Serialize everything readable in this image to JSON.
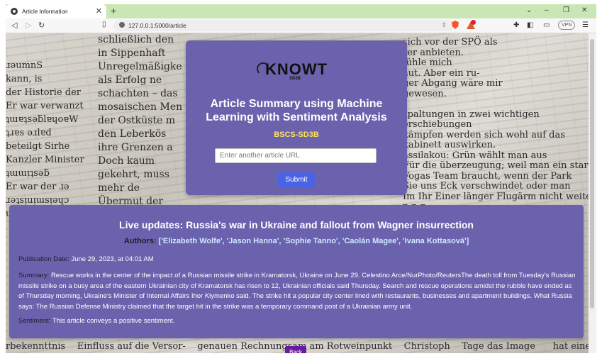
{
  "browser": {
    "tab_title": "Article Information",
    "new_tab": "+",
    "tab_close": "✕",
    "url": "127.0.0.1:5000/article",
    "vpn_label": "VPN",
    "window_controls": [
      "⌄",
      "–",
      "❐",
      "✕"
    ]
  },
  "header": {
    "logo_text": "KNOWT",
    "logo_subtext": "SD3B",
    "title": "Article Summary using Machine Learning with Sentiment Analysis",
    "course": "BSCS-SD3B",
    "url_input_placeholder": "Enter another article URL",
    "submit_label": "Submit"
  },
  "article": {
    "title": "Live updates: Russia's war in Ukraine and fallout from Wagner insurrection",
    "authors_label": "Authors:",
    "authors": "['Elizabeth Wolfe', 'Jason Hanna', 'Sophie Tanno', 'Caolán Magee', 'Ivana Kottasová']",
    "date_label": "Publication Date:",
    "date": "June 29, 2023, at 04:01 AM",
    "summary_label": "Summary:",
    "summary": "Rescue works in the center of the impact of a Russian missile strike in Kramatorsk, Ukraine on June 29. Celestino Arce/NurPhoto/ReutersThe death toll from Tuesday's Russian missile strike on a busy area of the eastern Ukrainian city of Kramatorsk has risen to 12, Ukrainian officials said Thursday. Search and rescue operations amidst the rubble have ended as of Thursday morning, Ukraine's Minister of Internal Affairs Ihor Klymenko said. The strike hit a popular city center lined with restaurants, businesses and apartment buildings. What Russia says: The Russian Defense Ministry claimed that the target hit in the strike was a temporary command post of a Ukrainian army unit.",
    "sentiment_label": "Sentiment:",
    "sentiment": "This article conveys a positive sentiment."
  },
  "back_label": "Back",
  "background_text": {
    "col1": "ɹǝumnS\nkann, is\nder Historie der\nEr war verwanzt\nʇɯɐʇsǝƃlɐɥoɐW\nʇɹɐs ǝɹlɐd\nbeteilgt Sirhe\nKanzler Minister\nʇɯɯᴉʇsǝƃ\nEr war der ɹǝ\nɹǝʇsᴉuᴉɯsᴉǝɥɔ\nuǝlɐᴉp ɹǝp",
    "col2": "schließlich den\nin Sippenhaft\nUnregelmäßigke\nals Erfolg ne\nschachten – das\nmosaischen Men\nder Ostküste m\nden Leberkös\nihre Grenzen a\nDoch kaum\ngekehrt, muss\nmehr de\nÜbermut der\nGestalt des\nminds He\ngeschlagen\nWiener Bl",
    "col3": "sich vor der SPÖ als\nrer anbieten.\nfühle mich\naut. Aber ein ru-\nger Abgang wäre mir\ngewesen.\n\nspaltungen in zwei wichtigen\nerschiebungen\nkämpfen werden sich wohl auf das\nkabinett auswirken.\nassilakou: Grün wählt man aus\nFür die überzeugung; weil man ein star-\nVogas Team braucht, wenn der Park\nSie uns Eck verschwindet oder man\nIm Ihr Einer länger Flugärm nicht weiter\nn n n . . .",
    "bottom": "rbekennttnis    Einfluss auf die Versor-    genauen Rechnungsam am Rotweinpunkt    Christoph    Tage das Image      hat einen ge-"
  }
}
